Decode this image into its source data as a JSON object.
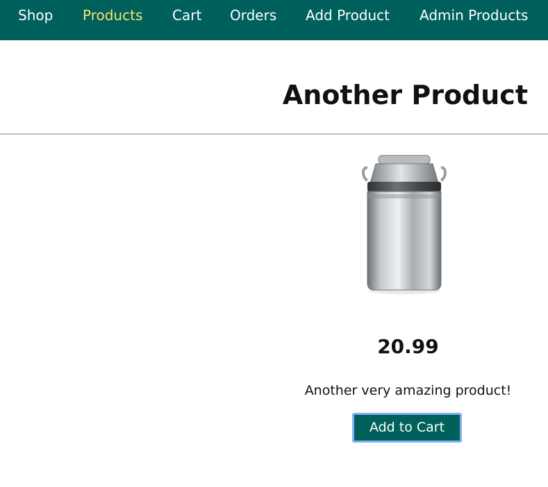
{
  "nav": {
    "items": [
      {
        "label": "Shop"
      },
      {
        "label": "Products"
      },
      {
        "label": "Cart"
      },
      {
        "label": "Orders"
      },
      {
        "label": "Add Product"
      },
      {
        "label": "Admin Products"
      }
    ],
    "active": "Products",
    "background_color": "#00605c",
    "active_color": "#f6e66c"
  },
  "product": {
    "title": "Another Product",
    "image_icon": "milk-can",
    "price": "20.99",
    "description": "Another very amazing product!",
    "add_to_cart_label": "Add to Cart"
  },
  "colors": {
    "accent": "#00605c",
    "button_focus_border": "#7fb2f0"
  }
}
